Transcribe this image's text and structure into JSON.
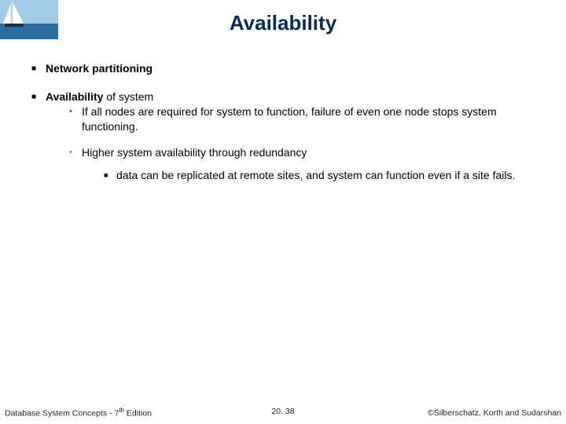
{
  "slide": {
    "title": "Availability",
    "bullets": {
      "b1": {
        "text": "Network partitioning"
      },
      "b2": {
        "bold": "Availability",
        "rest": " of system",
        "sub": {
          "s1": "If all nodes are required for system to function, failure of even one node stops system functioning.",
          "s2": {
            "text": "Higher system availability through redundancy",
            "sub": {
              "t1": "data can be replicated at remote sites, and system can function even if a site fails."
            }
          }
        }
      }
    }
  },
  "footer": {
    "left_a": "Database System Concepts - 7",
    "left_sup": "th",
    "left_b": " Edition",
    "center": "20. 38",
    "right": "©Silberschatz, Korth and Sudarshan"
  }
}
